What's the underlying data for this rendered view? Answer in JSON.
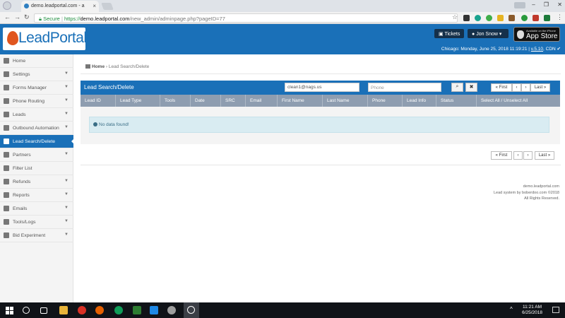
{
  "browser": {
    "tab_title": "demo.leadportal.com - a",
    "url_secure": "Secure",
    "url_proto": "https://",
    "url_host": "demo.leadportal.com",
    "url_path": "/new_admin/adminpage.php?pageID=77",
    "window_controls": "– ❐ ✕"
  },
  "header": {
    "logo_lead": "Lead",
    "logo_portal": "Portal",
    "tickets_label": "Tickets",
    "user_label": "Jon Snow",
    "appstore_small": "Available on the iPhone",
    "appstore_big": "App Store",
    "location_time": "Chicago: Monday, June 25, 2018 11:19:21 |",
    "version": "v.5.10",
    "cdn": "CDN"
  },
  "sidebar": {
    "items": [
      {
        "label": "Home",
        "icon": "home-icon"
      },
      {
        "label": "Settings",
        "icon": "wrench-icon"
      },
      {
        "label": "Forms Manager",
        "icon": "edit-icon"
      },
      {
        "label": "Phone Routing",
        "icon": "phone-icon"
      },
      {
        "label": "Leads",
        "icon": "users-icon"
      },
      {
        "label": "Outbound Automation",
        "icon": "refresh-icon"
      },
      {
        "label": "Lead Search/Delete",
        "icon": "search-icon"
      },
      {
        "label": "Partners",
        "icon": "partners-icon"
      },
      {
        "label": "Filter List",
        "icon": "filter-icon"
      },
      {
        "label": "Refunds",
        "icon": "money-bag-icon"
      },
      {
        "label": "Reports",
        "icon": "reports-icon"
      },
      {
        "label": "Emails",
        "icon": "envelope-icon"
      },
      {
        "label": "Tools/Logs",
        "icon": "tools-icon"
      },
      {
        "label": "Bid Experiment",
        "icon": "bid-icon"
      }
    ]
  },
  "breadcrumb": {
    "home": "Home",
    "sep": " › ",
    "current": "Lead Search/Delete"
  },
  "panel": {
    "title": "Lead Search/Delete",
    "email_value": "clean1@nags.us",
    "phone_placeholder": "Phone",
    "search_symbol": "🔍",
    "clear_symbol": "✖",
    "pager_first": "« First",
    "pager_prev": "‹",
    "pager_next": "›",
    "pager_last": "Last »"
  },
  "table": {
    "columns": [
      "Lead ID",
      "Lead Type",
      "Tools",
      "Date",
      "SRC",
      "Email",
      "First Name",
      "Last Name",
      "Phone",
      "Lead Info",
      "Status",
      "Select All / Unselect All"
    ],
    "empty_message": "No data found!"
  },
  "footer": {
    "line1": "demo.leadportal.com",
    "line2": "Lead system by boberdoo.com ©2018",
    "line3": "All Rights Reserved."
  },
  "taskbar": {
    "time": "11:21 AM",
    "date": "6/25/2018"
  },
  "colors": {
    "brand_blue": "#1a70b8",
    "table_header": "#8e9db0",
    "info_bg": "#d9ecf2"
  }
}
